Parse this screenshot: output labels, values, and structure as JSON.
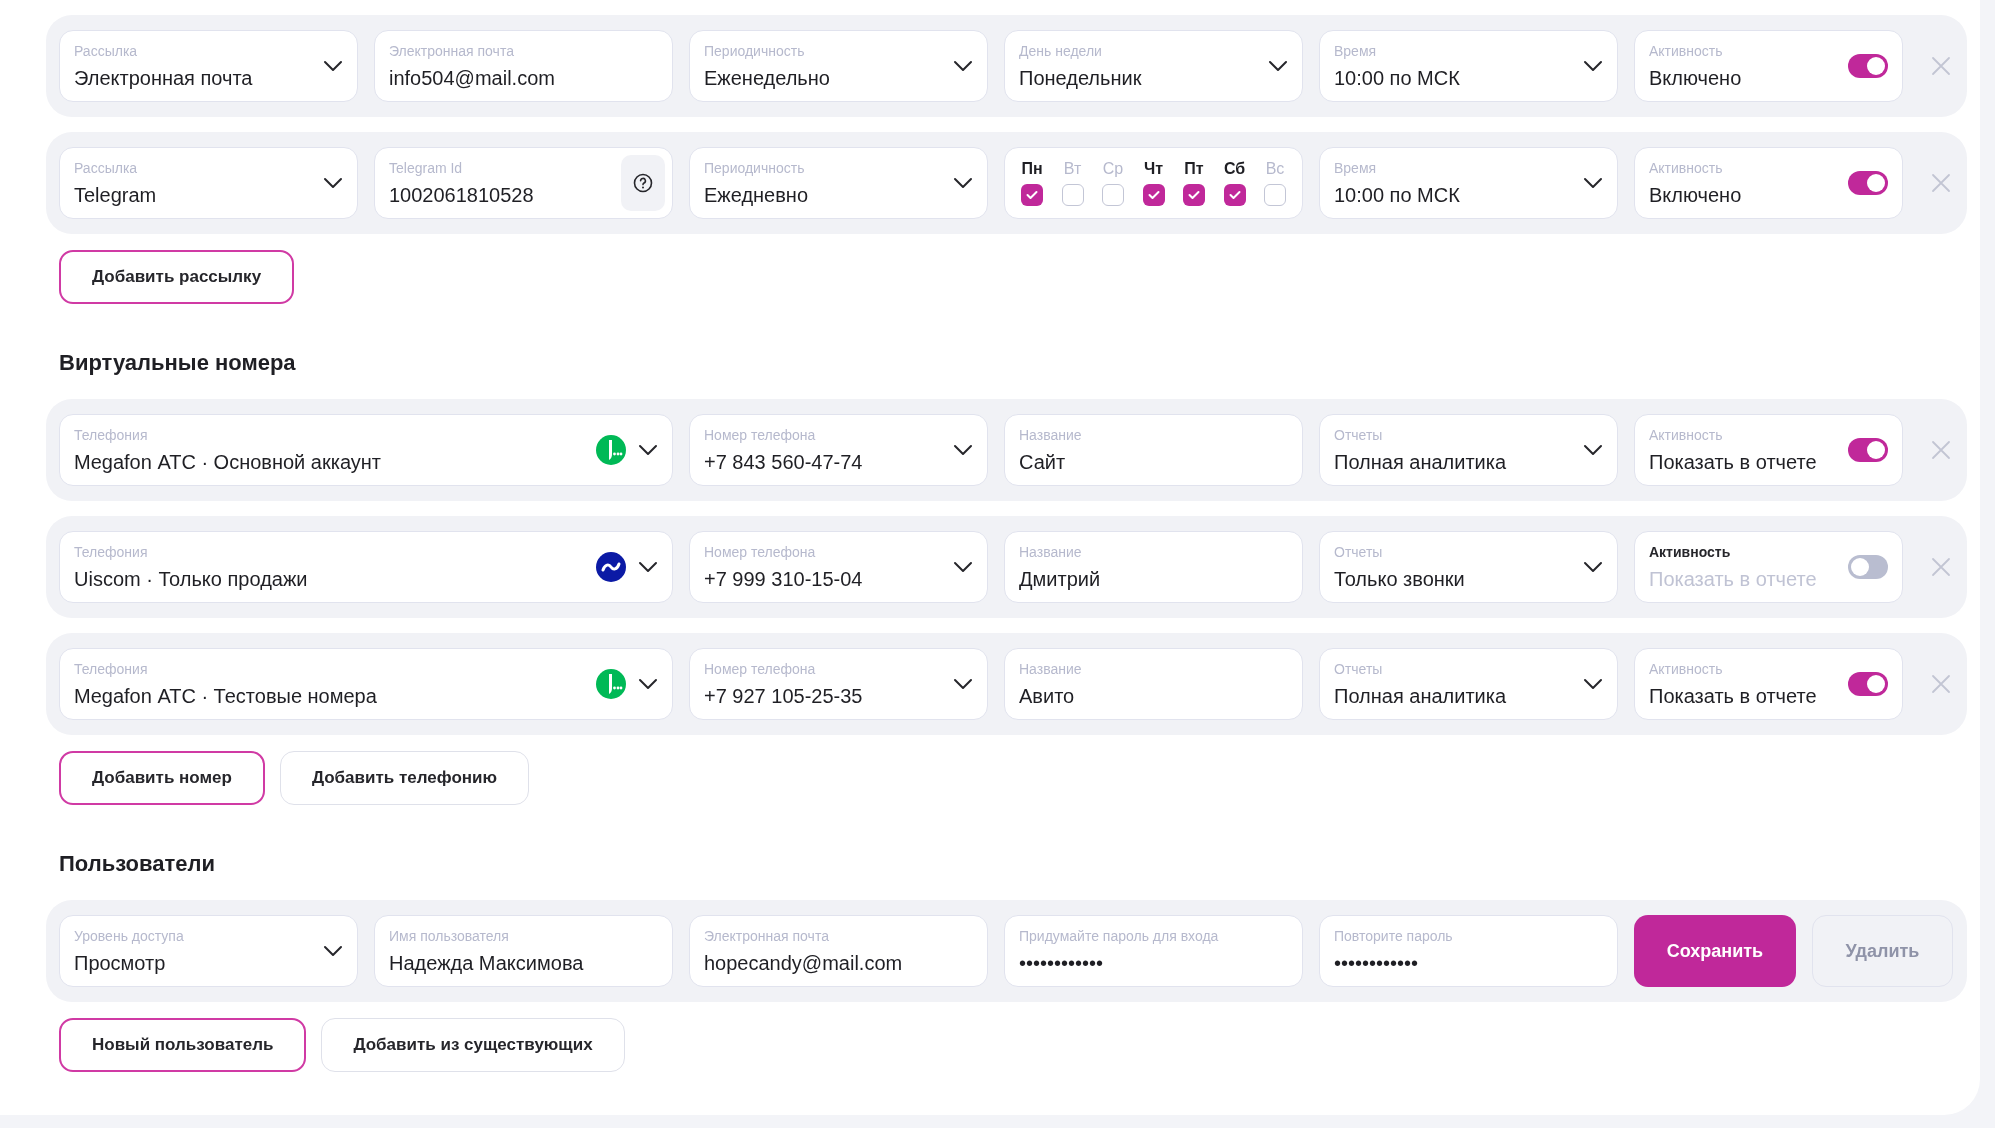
{
  "sections": [
    {
      "rows": [
        {
          "removable": true,
          "fields": [
            {
              "kind": "select",
              "label": "Рассылка",
              "value": "Электронная почта"
            },
            {
              "kind": "input",
              "label": "Электронная почта",
              "value": "info504@mail.com"
            },
            {
              "kind": "select",
              "label": "Периодичность",
              "value": "Еженедельно"
            },
            {
              "kind": "select",
              "label": "День недели",
              "value": "Понедельник"
            },
            {
              "kind": "select",
              "label": "Время",
              "value": "10:00 по МСК"
            },
            {
              "kind": "toggle",
              "label": "Активность",
              "value": "Включено",
              "on": true
            }
          ]
        },
        {
          "removable": true,
          "fields": [
            {
              "kind": "select",
              "label": "Рассылка",
              "value": "Telegram"
            },
            {
              "kind": "help_input",
              "label": "Telegram Id",
              "value": "1002061810528"
            },
            {
              "kind": "select",
              "label": "Периодичность",
              "value": "Ежедневно"
            },
            {
              "kind": "weekdays",
              "days": [
                {
                  "label": "Пн",
                  "checked": true
                },
                {
                  "label": "Вт",
                  "checked": false
                },
                {
                  "label": "Ср",
                  "checked": false
                },
                {
                  "label": "Чт",
                  "checked": true
                },
                {
                  "label": "Пт",
                  "checked": true
                },
                {
                  "label": "Сб",
                  "checked": true
                },
                {
                  "label": "Вс",
                  "checked": false
                }
              ]
            },
            {
              "kind": "select",
              "label": "Время",
              "value": "10:00 по МСК"
            },
            {
              "kind": "toggle",
              "label": "Активность",
              "value": "Включено",
              "on": true
            }
          ]
        }
      ],
      "buttons": [
        {
          "kind": "accent",
          "label": "Добавить рассылку"
        }
      ]
    },
    {
      "heading": "Виртуальные номера",
      "rows": [
        {
          "removable": true,
          "fields": [
            {
              "kind": "telephony",
              "label": "Телефония",
              "value": "Megafon АТС · Основной аккаунт",
              "logo": {
                "kind": "megafon"
              }
            },
            {
              "kind": "select",
              "label": "Номер телефона",
              "value": "+7 843 560-47-74"
            },
            {
              "kind": "input",
              "label": "Название",
              "value": "Сайт"
            },
            {
              "kind": "select",
              "label": "Отчеты",
              "value": "Полная аналитика"
            },
            {
              "kind": "toggle",
              "label": "Активность",
              "value": "Показать в отчете",
              "on": true
            }
          ]
        },
        {
          "removable": true,
          "fields": [
            {
              "kind": "telephony",
              "label": "Телефония",
              "value": "Uiscom · Только продажи",
              "logo": {
                "kind": "uiscom"
              }
            },
            {
              "kind": "select",
              "label": "Номер телефона",
              "value": "+7 999 310-15-04"
            },
            {
              "kind": "input",
              "label": "Название",
              "value": "Дмитрий"
            },
            {
              "kind": "select",
              "label": "Отчеты",
              "value": "Только звонки"
            },
            {
              "kind": "toggle",
              "label": "Активность",
              "value": "Показать в отчете",
              "on": false
            }
          ]
        },
        {
          "removable": true,
          "fields": [
            {
              "kind": "telephony",
              "label": "Телефония",
              "value": "Megafon АТС · Тестовые номера",
              "logo": {
                "kind": "megafon"
              }
            },
            {
              "kind": "select",
              "label": "Номер телефона",
              "value": "+7 927 105-25-35"
            },
            {
              "kind": "input",
              "label": "Название",
              "value": "Авито"
            },
            {
              "kind": "select",
              "label": "Отчеты",
              "value": "Полная аналитика"
            },
            {
              "kind": "toggle",
              "label": "Активность",
              "value": "Показать в отчете",
              "on": true
            }
          ]
        }
      ],
      "buttons": [
        {
          "kind": "accent",
          "label": "Добавить номер"
        },
        {
          "kind": "plain",
          "label": "Добавить телефонию"
        }
      ]
    },
    {
      "heading": "Пользователи",
      "rows": [
        {
          "removable": false,
          "fields": [
            {
              "kind": "select",
              "label": "Уровень доступа",
              "value": "Просмотр"
            },
            {
              "kind": "input",
              "label": "Имя пользователя",
              "value": "Надежда Максимова"
            },
            {
              "kind": "input",
              "label": "Электронная почта",
              "value": "hopecandy@mail.com"
            },
            {
              "kind": "password",
              "label": "Придумайте пароль для входа",
              "value": "••••••••••••"
            },
            {
              "kind": "password",
              "label": "Повторите пароль",
              "value": "••••••••••••"
            },
            {
              "kind": "save_button",
              "label": "Сохранить"
            },
            {
              "kind": "delete_button",
              "label": "Удалить",
              "disabled": true
            }
          ]
        }
      ],
      "buttons": [
        {
          "kind": "accent",
          "label": "Новый пользователь"
        },
        {
          "kind": "plain",
          "label": "Добавить из существующих"
        }
      ]
    }
  ]
}
